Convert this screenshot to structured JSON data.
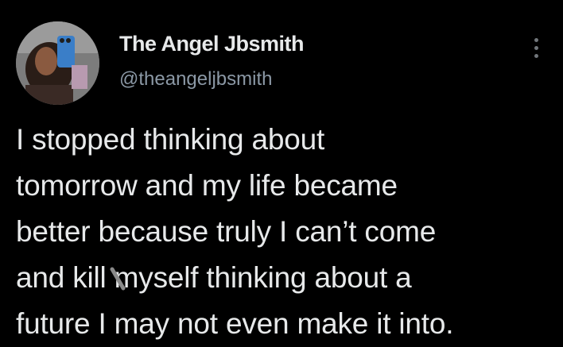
{
  "tweet": {
    "display_name": "The Angel Jbsmith",
    "handle": "@theangeljbsmith",
    "text": "I stopped thinking about\ntomorrow and my life became\nbetter because truly I can’t come\nand kill myself thinking about a\nfuture I may not even make it into."
  },
  "icons": {
    "more": "more-vertical-icon",
    "overlay": "slash-mark-icon"
  },
  "colors": {
    "background": "#000000",
    "primary_text": "#e7e9ea",
    "secondary_text": "#8b98a5"
  }
}
